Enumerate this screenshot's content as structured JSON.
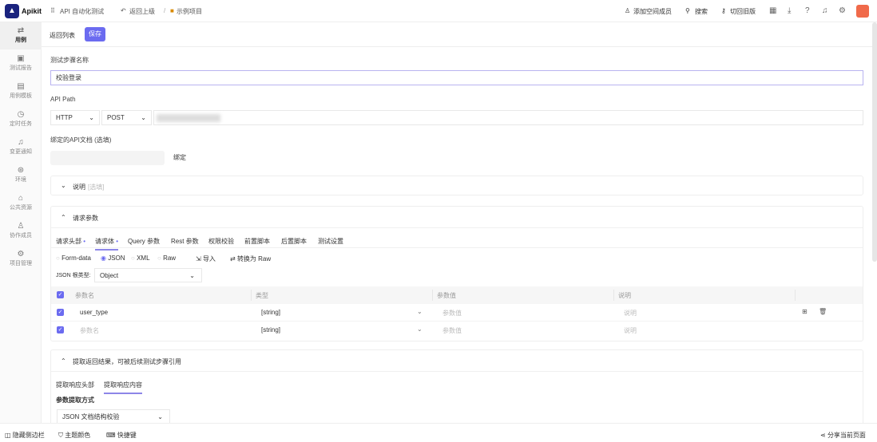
{
  "topbar": {
    "brand": "Apikit",
    "app": "API 自动化测试",
    "back": "返回上级",
    "sep": "/",
    "project": "示例项目",
    "add_member": "添加空间成员",
    "search": "搜索",
    "old_version": "切回旧版"
  },
  "sidebar": [
    {
      "label": "用例",
      "icon": "⇄"
    },
    {
      "label": "测试报告",
      "icon": "▣"
    },
    {
      "label": "用例模板",
      "icon": "▤"
    },
    {
      "label": "定时任务",
      "icon": "◷"
    },
    {
      "label": "变更通知",
      "icon": "♫"
    },
    {
      "label": "环境",
      "icon": "⊛"
    },
    {
      "label": "公共资源",
      "icon": "⌂"
    },
    {
      "label": "协作成员",
      "icon": "♙"
    },
    {
      "label": "项目管理",
      "icon": "⚙"
    }
  ],
  "toolbar": {
    "back_list": "返回列表",
    "save": "保存"
  },
  "form": {
    "step_name_label": "测试步骤名称",
    "step_name_value": "校验登录",
    "api_path_label": "API Path",
    "protocol": "HTTP",
    "method": "POST",
    "bind_label": "绑定的API文档 (选填)",
    "bind_button": "绑定"
  },
  "desc_panel": {
    "title": "说明",
    "hint": "[选填]"
  },
  "req_panel": {
    "title": "请求参数",
    "tabs": [
      "请求头部",
      "请求体",
      "Query 参数",
      "Rest 参数",
      "权限校验",
      "前置脚本",
      "后置脚本",
      "测试设置"
    ],
    "body_types": [
      "Form-data",
      "JSON",
      "XML",
      "Raw"
    ],
    "import": "导入",
    "convert": "转换为 Raw",
    "root_type_label": "JSON 根类型:",
    "root_type": "Object",
    "columns": [
      "参数名",
      "类型",
      "参数值",
      "说明"
    ],
    "rows": [
      {
        "name": "user_type",
        "type": "[string]",
        "value": "参数值",
        "desc": "说明"
      },
      {
        "name": "参数名",
        "type": "[string]",
        "value": "参数值",
        "desc": "说明"
      }
    ]
  },
  "extract_panel": {
    "title": "提取返回结果，可被后续测试步骤引用",
    "tabs": [
      "提取响应头部",
      "提取响应内容"
    ],
    "method_label": "参数提取方式",
    "method": "JSON 文档结构校验"
  },
  "bottom": {
    "hide_sidebar": "隐藏侧边栏",
    "theme": "主题颜色",
    "shortcuts": "快捷键",
    "share": "分享当前页面"
  }
}
